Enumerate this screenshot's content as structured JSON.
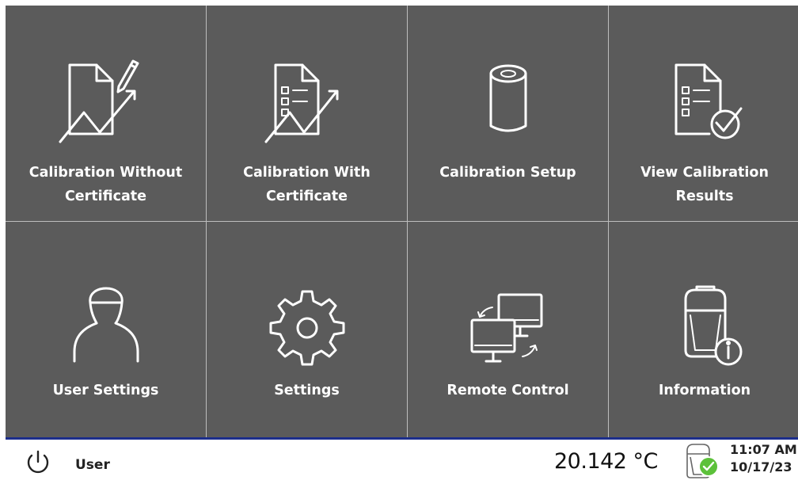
{
  "tiles": [
    {
      "label": "Calibration Without Certificate",
      "icon": "calibration-without-certificate-icon"
    },
    {
      "label": "Calibration With Certificate",
      "icon": "calibration-with-certificate-icon"
    },
    {
      "label": "Calibration Setup",
      "icon": "roll-icon"
    },
    {
      "label": "View Calibration Results",
      "icon": "checked-document-icon"
    },
    {
      "label": "User Settings",
      "icon": "user-icon"
    },
    {
      "label": "Settings",
      "icon": "gear-icon"
    },
    {
      "label": "Remote Control",
      "icon": "remote-monitors-icon"
    },
    {
      "label": "Information",
      "icon": "device-info-icon"
    }
  ],
  "status": {
    "user": "User",
    "temperature": "20.142 °C",
    "time": "11:07 AM",
    "date": "10/17/23"
  },
  "colors": {
    "tile_bg": "#5b5b5b",
    "grid_line": "#bdbdbd",
    "status_bar_accent": "#1c2e8c",
    "ok_green": "#5cc13a"
  }
}
